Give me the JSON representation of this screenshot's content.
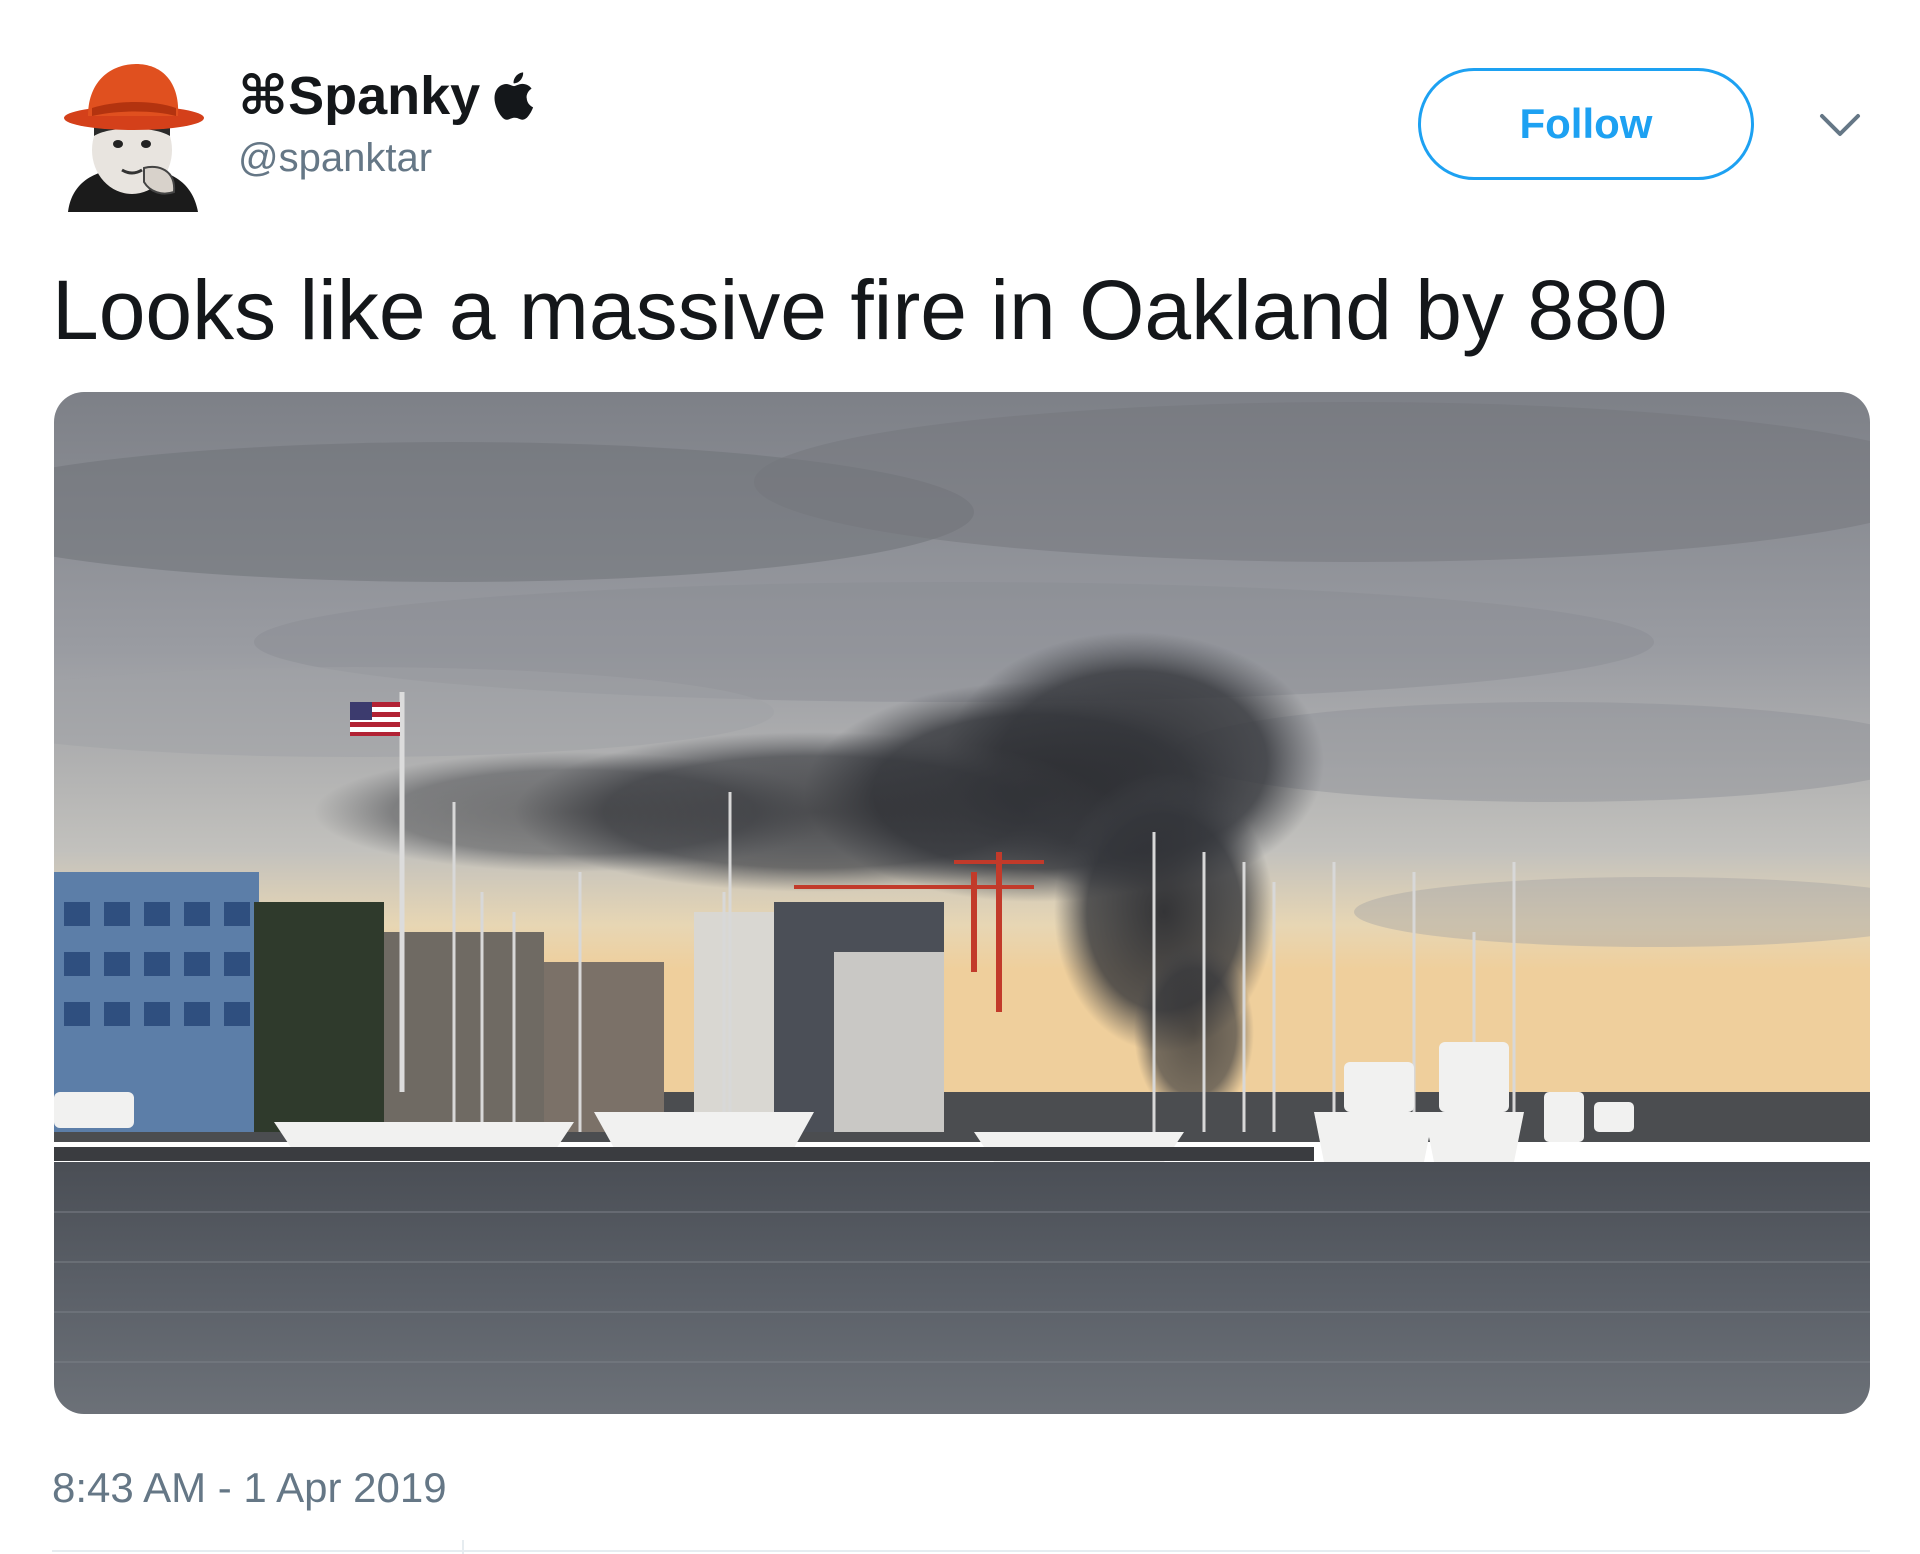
{
  "user": {
    "display_name_prefix": "⌘",
    "display_name": "Spanky",
    "handle": "@spanktar",
    "badge_icon": "apple-logo-icon"
  },
  "actions": {
    "follow_label": "Follow",
    "menu_icon": "chevron-down-icon"
  },
  "tweet": {
    "text": "Looks like a massive fire in Oakland by 880",
    "timestamp": "8:43 AM - 1 Apr 2019"
  },
  "colors": {
    "accent": "#1da1f2",
    "text_primary": "#14171a",
    "text_secondary": "#657786",
    "divider": "#e6ecf0"
  }
}
